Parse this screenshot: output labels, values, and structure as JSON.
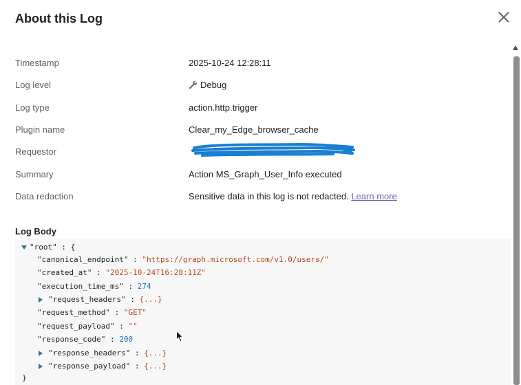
{
  "dialog": {
    "title": "About this Log",
    "close_icon": "close-icon"
  },
  "fields": {
    "timestamp": {
      "label": "Timestamp",
      "value": "2025-10-24 12:28:11"
    },
    "log_level": {
      "label": "Log level",
      "value": "Debug",
      "icon": "wrench-icon"
    },
    "log_type": {
      "label": "Log type",
      "value": "action.http.trigger"
    },
    "plugin_name": {
      "label": "Plugin name",
      "value": "Clear_my_Edge_browser_cache"
    },
    "requestor": {
      "label": "Requestor",
      "value_state": "redacted with blue scribble"
    },
    "summary": {
      "label": "Summary",
      "value": "Action MS_Graph_User_Info executed"
    },
    "data_redaction": {
      "label": "Data redaction",
      "value": "Sensitive data in this log is not redacted.",
      "link": "Learn more"
    }
  },
  "log_body": {
    "title": "Log Body",
    "root_key": "\"root\"",
    "canonical_endpoint_key": "\"canonical_endpoint\"",
    "canonical_endpoint_value": "\"https://graph.microsoft.com/v1.0/users/\"",
    "created_at_key": "\"created_at\"",
    "created_at_value": "\"2025-10-24T16:28:11Z\"",
    "execution_time_key": "\"execution_time_ms\"",
    "execution_time_value": "274",
    "request_headers_key": "\"request_headers\"",
    "request_method_key": "\"request_method\"",
    "request_method_value": "\"GET\"",
    "request_payload_key": "\"request_payload\"",
    "request_payload_value": "\"\"",
    "response_code_key": "\"response_code\"",
    "response_code_value": "200",
    "response_headers_key": "\"response_headers\"",
    "response_payload_key": "\"response_payload\"",
    "collapsed_value": "{...}",
    "colon": ":",
    "open_brace": "{",
    "close_brace": "}"
  },
  "colors": {
    "string": "#b5461a",
    "number": "#1a6fb5",
    "link": "#6b5fb0",
    "redaction_scribble": "#1a7fd1"
  }
}
